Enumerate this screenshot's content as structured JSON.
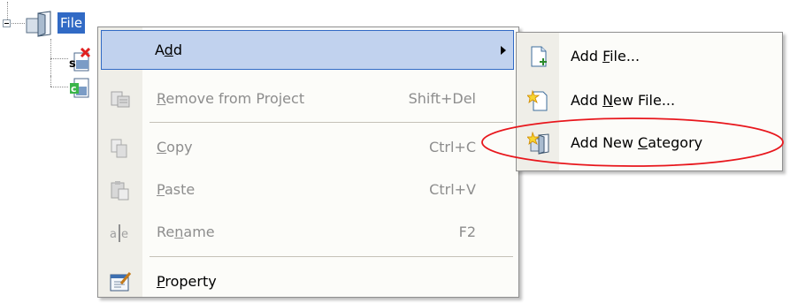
{
  "tree": {
    "root_label": "File",
    "root_icon": "project-folder-icon",
    "children": [
      {
        "icon": "source-file-error-icon"
      },
      {
        "icon": "c-source-file-icon"
      }
    ]
  },
  "context_menu": {
    "items": [
      {
        "label": "Add",
        "mnemonic_index": 1,
        "shortcut": "",
        "enabled": true,
        "highlighted": true,
        "submenu": true,
        "icon": ""
      },
      {
        "label": "Remove from Project",
        "mnemonic_index": 0,
        "shortcut": "Shift+Del",
        "enabled": false,
        "icon": "remove-from-project-icon"
      },
      {
        "label": "Copy",
        "mnemonic_index": 0,
        "shortcut": "Ctrl+C",
        "enabled": false,
        "icon": "copy-icon"
      },
      {
        "label": "Paste",
        "mnemonic_index": 0,
        "shortcut": "Ctrl+V",
        "enabled": false,
        "icon": "paste-icon"
      },
      {
        "label": "Rename",
        "mnemonic_index": 2,
        "shortcut": "F2",
        "enabled": false,
        "icon": "rename-icon"
      },
      {
        "label": "Property",
        "mnemonic_index": 0,
        "shortcut": "",
        "enabled": true,
        "icon": "property-icon"
      }
    ]
  },
  "submenu": {
    "items": [
      {
        "label": "Add File...",
        "mnemonic_index": 4,
        "icon": "add-file-icon"
      },
      {
        "label": "Add New File...",
        "mnemonic_index": 4,
        "icon": "add-new-file-icon"
      },
      {
        "label": "Add New Category",
        "mnemonic_index": 8,
        "icon": "add-new-category-icon",
        "annotated": true
      }
    ]
  },
  "colors": {
    "selection": "#316ac5",
    "menu_highlight": "#c1d2ee",
    "menu_background": "#fcfcf9",
    "gutter": "#efeee8",
    "disabled_text": "#8d8d8d",
    "annotation": "#e8161c"
  }
}
